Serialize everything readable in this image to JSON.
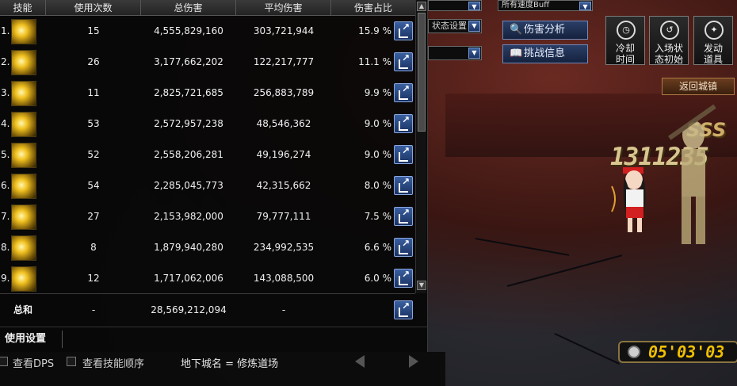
{
  "hud": {
    "buff_select": "所有速度Buff",
    "state_select": "状态设置",
    "damage_analysis": "伤害分析",
    "challenge_info": "挑战信息",
    "cooldown_line1": "冷却",
    "cooldown_line2": "时间",
    "entry_line1": "入场状",
    "entry_line2": "态初始",
    "item_line1": "发动",
    "item_line2": "道具",
    "return_town": "返回城镇",
    "combo": "1311235",
    "rank": "SSS",
    "timer": "05'03'03"
  },
  "table": {
    "headers": [
      "技能",
      "使用次数",
      "总伤害",
      "平均伤害",
      "伤害占比"
    ],
    "rows": [
      {
        "idx": "1.",
        "uses": "15",
        "total": "4,555,829,160",
        "avg": "303,721,944",
        "pct": "15.9 %"
      },
      {
        "idx": "2.",
        "uses": "26",
        "total": "3,177,662,202",
        "avg": "122,217,777",
        "pct": "11.1 %"
      },
      {
        "idx": "3.",
        "uses": "11",
        "total": "2,825,721,685",
        "avg": "256,883,789",
        "pct": "9.9 %"
      },
      {
        "idx": "4.",
        "uses": "53",
        "total": "2,572,957,238",
        "avg": "48,546,362",
        "pct": "9.0 %"
      },
      {
        "idx": "5.",
        "uses": "52",
        "total": "2,558,206,281",
        "avg": "49,196,274",
        "pct": "9.0 %"
      },
      {
        "idx": "6.",
        "uses": "54",
        "total": "2,285,045,773",
        "avg": "42,315,662",
        "pct": "8.0 %"
      },
      {
        "idx": "7.",
        "uses": "27",
        "total": "2,153,982,000",
        "avg": "79,777,111",
        "pct": "7.5 %"
      },
      {
        "idx": "8.",
        "uses": "8",
        "total": "1,879,940,280",
        "avg": "234,992,535",
        "pct": "6.6 %"
      },
      {
        "idx": "9.",
        "uses": "12",
        "total": "1,717,062,006",
        "avg": "143,088,500",
        "pct": "6.0 %"
      }
    ],
    "total": {
      "label": "总和",
      "uses": "-",
      "total": "28,569,212,094",
      "avg": "-"
    }
  },
  "settings": {
    "label": "使用设置"
  },
  "footer": {
    "show_dps": "查看DPS",
    "show_order": "查看技能顺序",
    "dungeon": "地下城名 = 修炼道场"
  },
  "colors": {
    "accent": "#3a5fa0",
    "gold": "#f0c000"
  }
}
